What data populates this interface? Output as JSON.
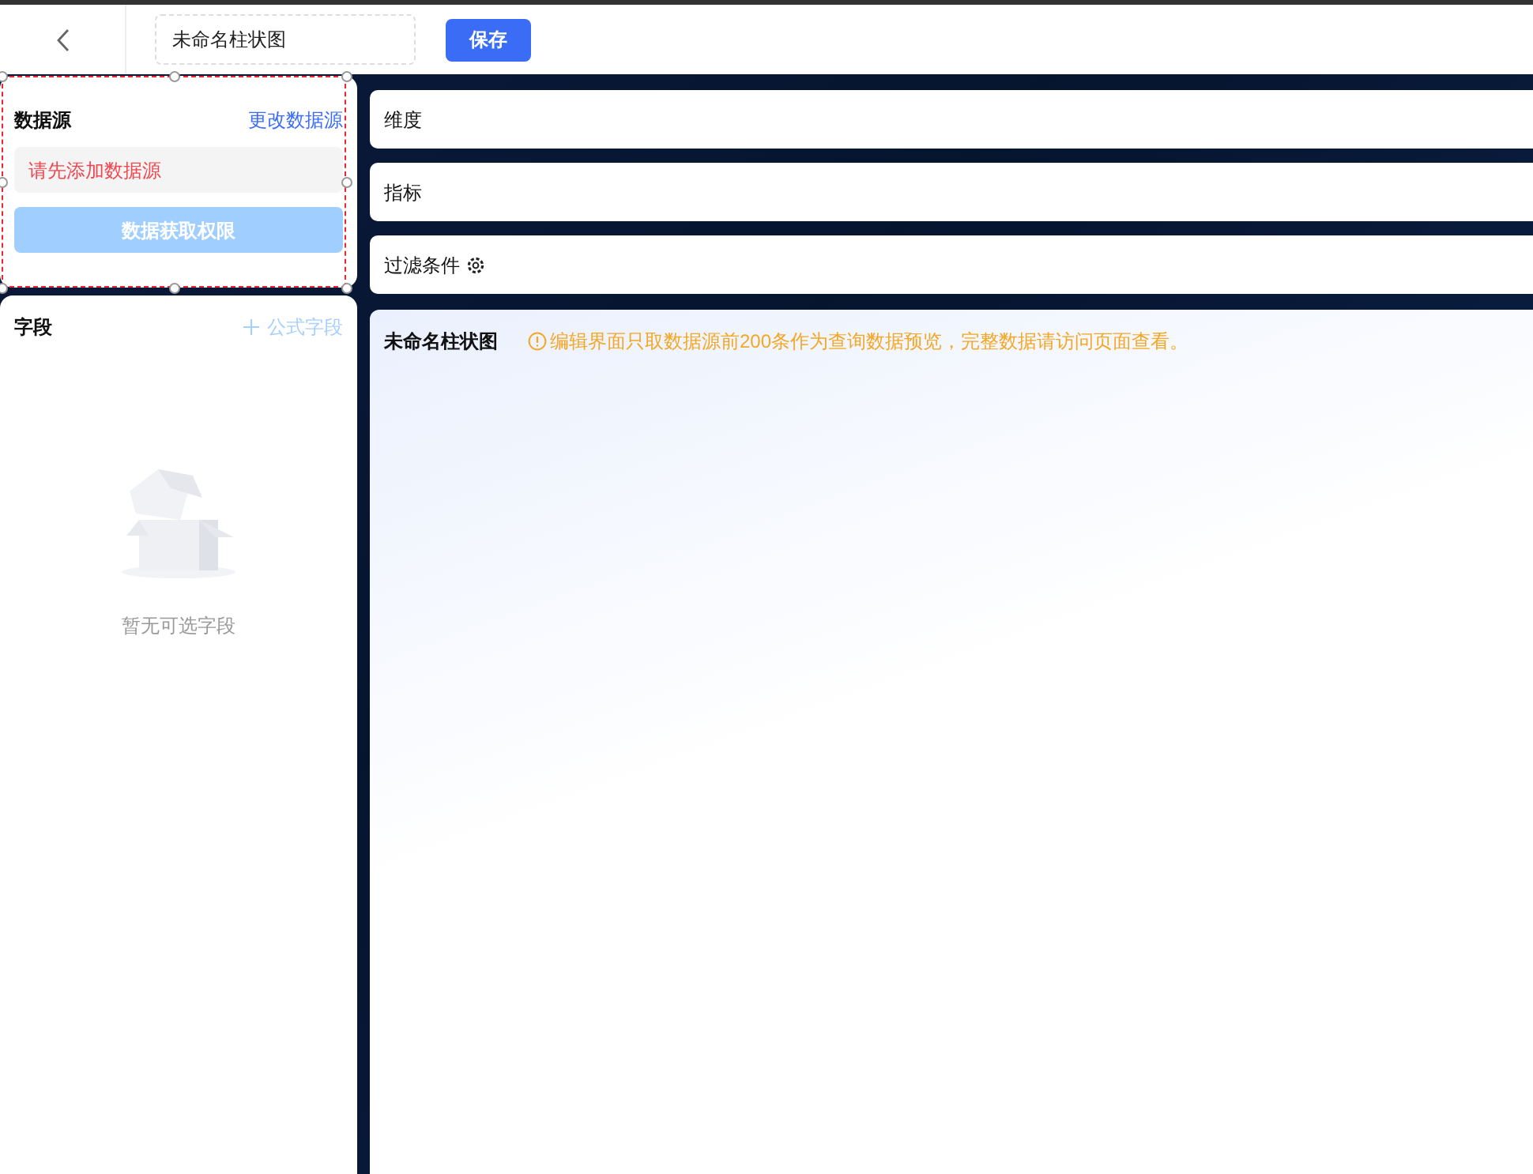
{
  "header": {
    "title_value": "未命名柱状图",
    "save_button": "保存"
  },
  "data_source": {
    "selected": true,
    "title": "数据源",
    "change_link": "更改数据源",
    "warning": "请先添加数据源",
    "permission_button": {
      "label": "数据获取权限",
      "disabled": true
    }
  },
  "fields": {
    "title": "字段",
    "add_formula": {
      "label": "公式字段",
      "disabled": true
    },
    "empty_text": "暂无可选字段"
  },
  "sections": [
    {
      "label": "维度",
      "kind": "plain"
    },
    {
      "label": "指标",
      "kind": "plain"
    },
    {
      "label": "过滤条件",
      "kind": "settings"
    }
  ],
  "chart": {
    "title": "未命名柱状图",
    "notice": "编辑界面只取数据源前200条作为查询数据预览，完整数据请访问页面查看。"
  }
}
